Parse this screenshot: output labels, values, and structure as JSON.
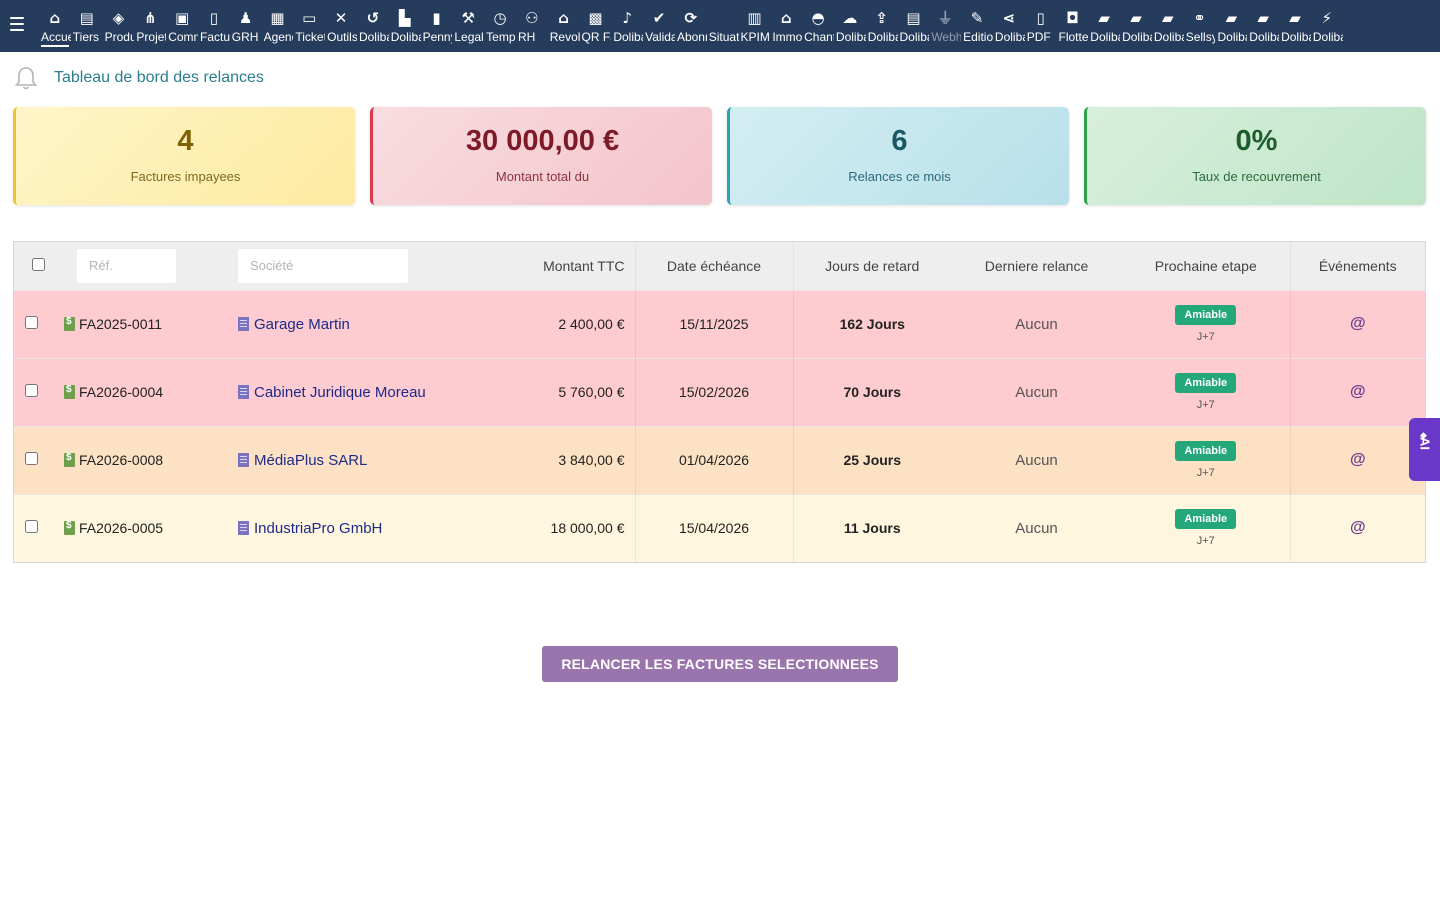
{
  "topbar": {
    "menu": [
      {
        "label": "Accueil",
        "icon": "home-icon",
        "glyph": "⌂",
        "active": true
      },
      {
        "label": "Tiers",
        "icon": "building-icon",
        "glyph": "▤"
      },
      {
        "label": "Produits",
        "icon": "cube-icon",
        "glyph": "◈"
      },
      {
        "label": "Projets",
        "icon": "sitemap-icon",
        "glyph": "⋔"
      },
      {
        "label": "Commercial",
        "icon": "suitcase-icon",
        "glyph": "▣"
      },
      {
        "label": "Facturation",
        "icon": "invoice-icon",
        "glyph": "▯"
      },
      {
        "label": "GRH",
        "icon": "users-icon",
        "glyph": "♟"
      },
      {
        "label": "Agenda",
        "icon": "calendar-icon",
        "glyph": "▦"
      },
      {
        "label": "Tickets",
        "icon": "ticket-icon",
        "glyph": "▭"
      },
      {
        "label": "Outils",
        "icon": "tools-icon",
        "glyph": "✕"
      },
      {
        "label": "Dolibarr",
        "icon": "undo-icon",
        "glyph": "↺"
      },
      {
        "label": "Dolibarr",
        "icon": "briefcase-file-icon",
        "glyph": "▙"
      },
      {
        "label": "Penny",
        "icon": "note-icon",
        "glyph": "▮"
      },
      {
        "label": "Legal",
        "icon": "gavel-icon",
        "glyph": "⚒"
      },
      {
        "label": "Temps",
        "icon": "clock-icon",
        "glyph": "◷"
      },
      {
        "label": "RH",
        "icon": "team-icon",
        "glyph": "⚇"
      },
      {
        "label": "Revolut",
        "icon": "bank-icon",
        "glyph": "⌂"
      },
      {
        "label": "QR Factures",
        "icon": "qrcode-icon",
        "glyph": "▩"
      },
      {
        "label": "Dolibarr",
        "icon": "bell-icon",
        "glyph": "♪"
      },
      {
        "label": "Validation",
        "icon": "double-check-icon",
        "glyph": "✔"
      },
      {
        "label": "Abonnements",
        "icon": "sync-icon",
        "glyph": "⟳"
      },
      {
        "label": "Situation",
        "icon": "blank-icon",
        "glyph": ""
      },
      {
        "label": "KPIMetrics",
        "icon": "bar-chart-icon",
        "glyph": "▥"
      },
      {
        "label": "Immobilier",
        "icon": "house-icon",
        "glyph": "⌂"
      },
      {
        "label": "Chantiers",
        "icon": "hardhat-icon",
        "glyph": "◓"
      },
      {
        "label": "Dolibarr",
        "icon": "cloud-icon",
        "glyph": "☁"
      },
      {
        "label": "Dolibarr",
        "icon": "upload-file-icon",
        "glyph": "⇪"
      },
      {
        "label": "Dolibarr",
        "icon": "building-icon",
        "glyph": "▤"
      },
      {
        "label": "Webhooks",
        "icon": "plug-icon",
        "glyph": "⏚",
        "dim": true
      },
      {
        "label": "Edition",
        "icon": "edit-icon",
        "glyph": "✎"
      },
      {
        "label": "Dolibarr",
        "icon": "share-icon",
        "glyph": "⋖"
      },
      {
        "label": "PDF",
        "icon": "pdf-file-icon",
        "glyph": "▯"
      },
      {
        "label": "Flotte",
        "icon": "car-icon",
        "glyph": "◘"
      },
      {
        "label": "Dolibarr",
        "icon": "sticky-note-icon",
        "glyph": "▰"
      },
      {
        "label": "Dolibarr",
        "icon": "sticky-note-icon",
        "glyph": "▰"
      },
      {
        "label": "Dolibarr",
        "icon": "sticky-note-icon",
        "glyph": "▰"
      },
      {
        "label": "Sellsy",
        "icon": "handshake-icon",
        "glyph": "⚭"
      },
      {
        "label": "Dolibarr",
        "icon": "sticky-note-icon",
        "glyph": "▰"
      },
      {
        "label": "Dolibarr",
        "icon": "sticky-note-icon",
        "glyph": "▰"
      },
      {
        "label": "Dolibarr",
        "icon": "sticky-note-icon",
        "glyph": "▰"
      },
      {
        "label": "Dolibarr",
        "icon": "magic-wand-icon",
        "glyph": "⚡"
      }
    ]
  },
  "page": {
    "title": "Tableau de bord des relances"
  },
  "kpis": [
    {
      "value": "4",
      "label": "Factures impayees"
    },
    {
      "value": "30 000,00 €",
      "label": "Montant total du"
    },
    {
      "value": "6",
      "label": "Relances ce mois"
    },
    {
      "value": "0%",
      "label": "Taux de recouvrement"
    }
  ],
  "table": {
    "filters": {
      "ref_placeholder": "Réf.",
      "societe_placeholder": "Société"
    },
    "headers": {
      "montant": "Montant TTC",
      "echeance": "Date échéance",
      "retard": "Jours de retard",
      "derniere": "Derniere relance",
      "prochaine": "Prochaine etape",
      "evenements": "Événements"
    },
    "rows": [
      {
        "ref": "FA2025-0011",
        "societe": "Garage Martin",
        "montant": "2 400,00 €",
        "echeance": "15/11/2025",
        "retard": "162 Jours",
        "derniere": "Aucun",
        "etape": "Amiable",
        "delai": "J+7",
        "event": "@",
        "tone": "red"
      },
      {
        "ref": "FA2026-0004",
        "societe": "Cabinet Juridique Moreau",
        "montant": "5 760,00 €",
        "echeance": "15/02/2026",
        "retard": "70 Jours",
        "derniere": "Aucun",
        "etape": "Amiable",
        "delai": "J+7",
        "event": "@",
        "tone": "red"
      },
      {
        "ref": "FA2026-0008",
        "societe": "MédiaPlus SARL",
        "montant": "3 840,00 €",
        "echeance": "01/04/2026",
        "retard": "25 Jours",
        "derniere": "Aucun",
        "etape": "Amiable",
        "delai": "J+7",
        "event": "@",
        "tone": "orange"
      },
      {
        "ref": "FA2026-0005",
        "societe": "IndustriaPro GmbH",
        "montant": "18 000,00 €",
        "echeance": "15/04/2026",
        "retard": "11 Jours",
        "derniere": "Aucun",
        "etape": "Amiable",
        "delai": "J+7",
        "event": "@",
        "tone": "cream"
      }
    ]
  },
  "actions": {
    "relancer_label": "RELANCER LES FACTURES SELECTIONNEES"
  },
  "ai_tab": {
    "label": "AI",
    "glyph": "◆"
  },
  "colors": {
    "topbar": "#263c5c",
    "accent_title": "#2a7e8d",
    "row_red": "#fdcbd0",
    "row_orange": "#fde1c4",
    "row_cream": "#fef6de",
    "badge_green": "#24a779",
    "action_purple": "#9a74ad",
    "ai_purple": "#6a38c8"
  }
}
